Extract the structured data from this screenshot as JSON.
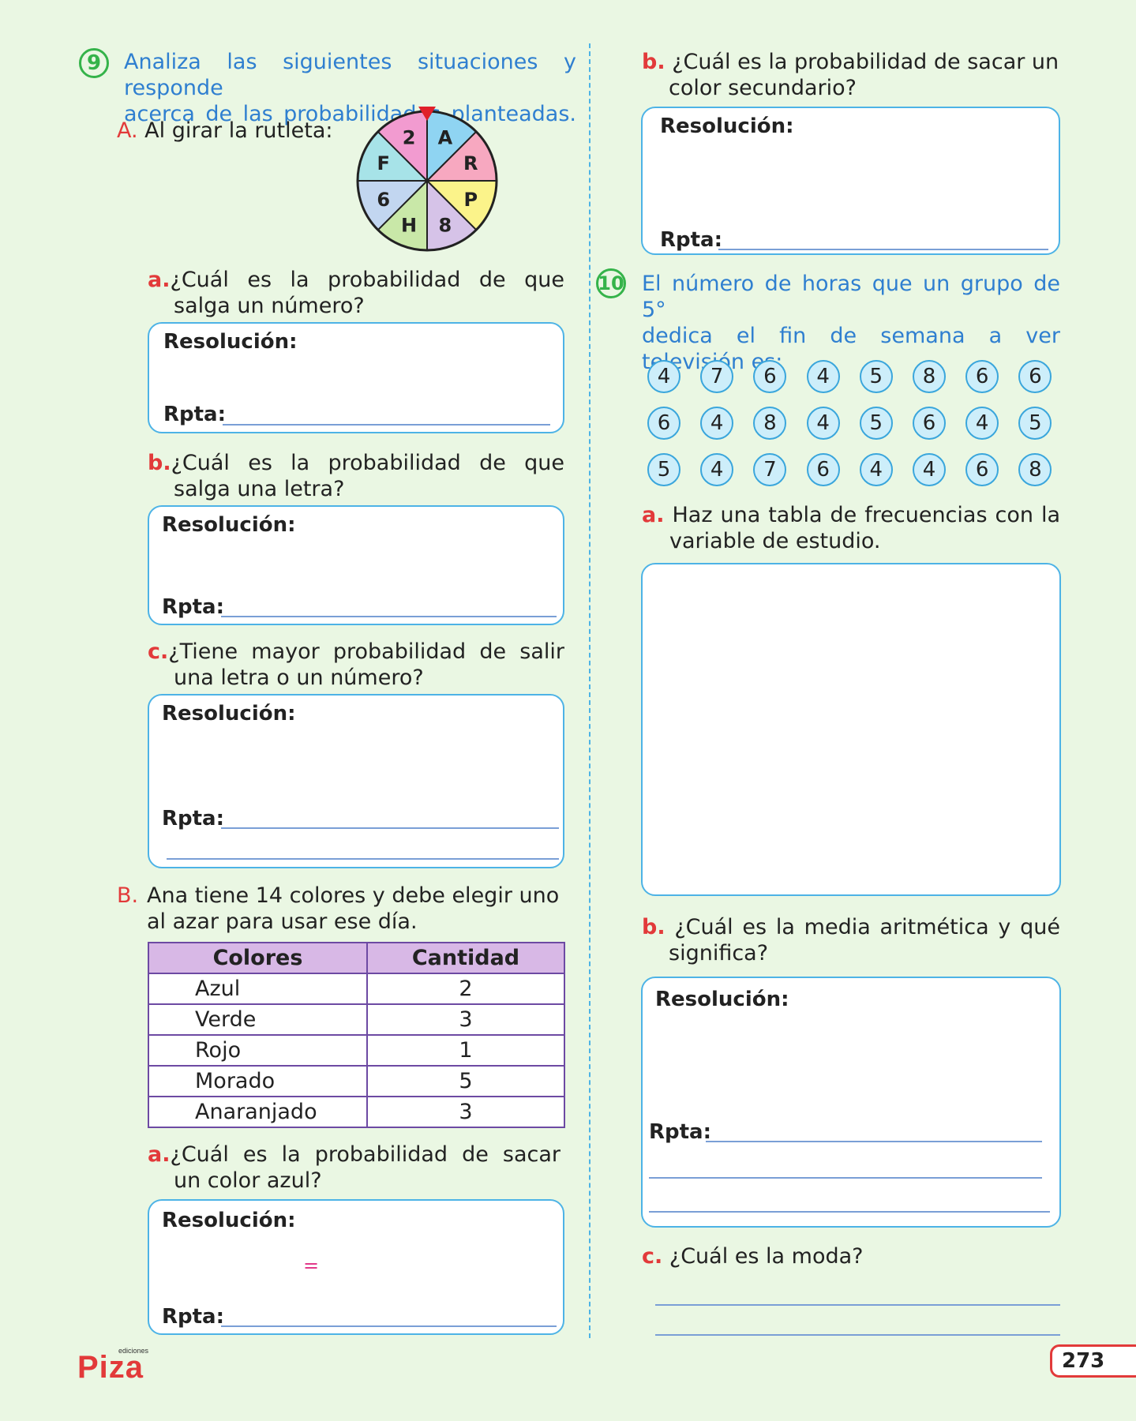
{
  "q9": {
    "number": "9",
    "intro_line1": "Analiza las siguientes situaciones y responde",
    "intro_line2": "acerca de las probabilidades planteadas.",
    "A": {
      "marker": "A.",
      "text": "Al girar la rutleta:",
      "roulette": {
        "sectors": [
          {
            "label": "A",
            "color": "#8fd4f2"
          },
          {
            "label": "R",
            "color": "#f7a8c0"
          },
          {
            "label": "P",
            "color": "#fbf38a"
          },
          {
            "label": "8",
            "color": "#d6c3e8"
          },
          {
            "label": "H",
            "color": "#c9e8a8"
          },
          {
            "label": "6",
            "color": "#c2d6f0"
          },
          {
            "label": "F",
            "color": "#a7e3e8"
          },
          {
            "label": "2",
            "color": "#f29bd0"
          }
        ]
      },
      "a": {
        "marker": "a.",
        "line1": "¿Cuál es la probabilidad de que",
        "line2": "salga un número?"
      },
      "b": {
        "marker": "b.",
        "line1": "¿Cuál es la probabilidad de que",
        "line2": "salga una letra?"
      },
      "c": {
        "marker": "c.",
        "line1": "¿Tiene mayor probabilidad de salir",
        "line2": "una letra o un número?"
      }
    },
    "B": {
      "marker": "B.",
      "line1": "Ana tiene 14  colores y debe elegir uno",
      "line2": "al azar para usar ese día.",
      "table": {
        "headers": [
          "Colores",
          "Cantidad"
        ],
        "rows": [
          [
            "Azul",
            "2"
          ],
          [
            "Verde",
            "3"
          ],
          [
            "Rojo",
            "1"
          ],
          [
            "Morado",
            "5"
          ],
          [
            "Anaranjado",
            "3"
          ]
        ]
      },
      "a": {
        "marker": "a.",
        "line1": "¿Cuál es la probabilidad de sacar",
        "line2": "un color azul?",
        "equals": "="
      },
      "b": {
        "marker": "b.",
        "line1": "¿Cuál es la probabilidad de sacar un",
        "line2": "color secundario?"
      }
    }
  },
  "labels": {
    "resolucion": "Resolución:",
    "rpta": "Rpta:"
  },
  "q10": {
    "number": "10",
    "line1": "El número de horas que un grupo de 5°",
    "line2": "dedica el fin de semana a ver",
    "line3": "televisión es:",
    "data_rows": [
      [
        "4",
        "7",
        "6",
        "4",
        "5",
        "8",
        "6",
        "6"
      ],
      [
        "6",
        "4",
        "8",
        "4",
        "5",
        "6",
        "4",
        "5"
      ],
      [
        "5",
        "4",
        "7",
        "6",
        "4",
        "4",
        "6",
        "8"
      ]
    ],
    "a": {
      "marker": "a.",
      "line1": "Haz una tabla de frecuencias con la",
      "line2": "variable de estudio."
    },
    "b": {
      "marker": "b.",
      "line1": "¿Cuál es la media aritmética y qué",
      "line2": "significa?"
    },
    "c": {
      "marker": "c.",
      "text": "¿Cuál es la moda?"
    }
  },
  "footer": {
    "logo": "Piza",
    "logo_small": "ediciones",
    "page": "273"
  }
}
